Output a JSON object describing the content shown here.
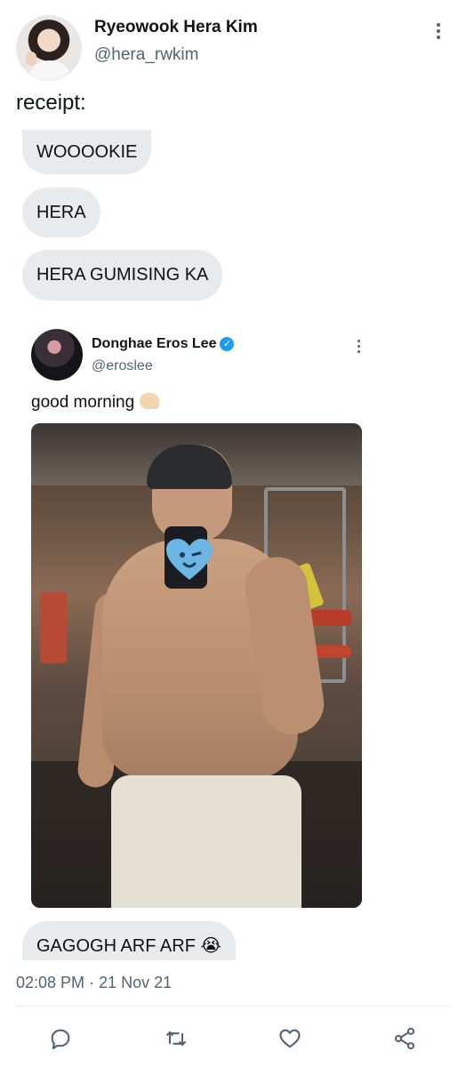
{
  "user": {
    "name": "Ryeowook Hera Kim",
    "handle": "@hera_rwkim"
  },
  "tweet": {
    "text": "receipt:",
    "bubbles": [
      "WOOOOKIE",
      "HERA",
      "HERA GUMISING KA",
      "GAGOGH ARF ARF 😭"
    ],
    "timestamp": "02:08 PM · 21 Nov 21"
  },
  "quoted": {
    "name": "Donghae Eros Lee",
    "handle": "@eroslee",
    "text": "good morning",
    "verified": true,
    "photo_description_icon": "gym-selfie-photo",
    "sticker_icon": "blue-heart-sticker"
  },
  "actions": [
    {
      "icon": "reply-icon"
    },
    {
      "icon": "retweet-icon"
    },
    {
      "icon": "like-icon"
    },
    {
      "icon": "share-icon"
    }
  ],
  "colors": {
    "bubble": "#e8ebee",
    "muted": "#536471",
    "text": "#0f1419",
    "verified": "#1d9bf0"
  }
}
